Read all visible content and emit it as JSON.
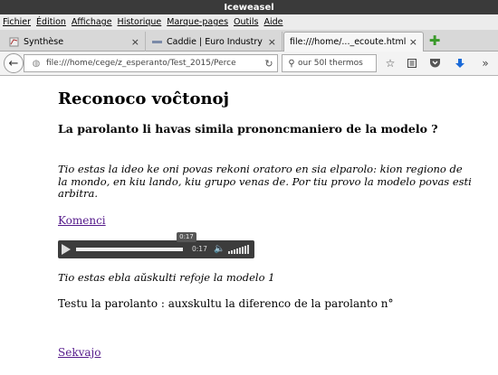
{
  "window": {
    "title": "Iceweasel"
  },
  "menu": [
    "Fichier",
    "Édition",
    "Affichage",
    "Historique",
    "Marque-pages",
    "Outils",
    "Aide"
  ],
  "tabs": [
    {
      "label": "Synthèse",
      "close": "×"
    },
    {
      "label": "Caddie | Euro Industry",
      "close": "×"
    },
    {
      "label": "file:///home/..._ecoute.html",
      "close": "×"
    }
  ],
  "newtab_label": "✚",
  "nav": {
    "url": "file:///home/cege/z_esperanto/Test_2015/Perce",
    "search_value": "our 50l thermos"
  },
  "page": {
    "title": "Reconoco voĉtonoj",
    "question": "La parolanto li havas simila prononcmaniero de la modelo ?",
    "description": "Tio estas la ideo ke oni povas rekoni oratoro en sia elparolo: kion regiono de la mondo, en kiu lando, kiu grupo venas de. Por tiu provo la modelo povas esti arbitra.",
    "start_link": "Komenci",
    "audio": {
      "time": "0:17",
      "tooltip": "0:17",
      "progress": 1.0
    },
    "caption": "Tio estas ebla aŭskulti refoje la modelo 1",
    "task": "Testu la parolanto : auxskultu la diferenco de la parolanto n°",
    "next_link": "Sekvajo"
  }
}
